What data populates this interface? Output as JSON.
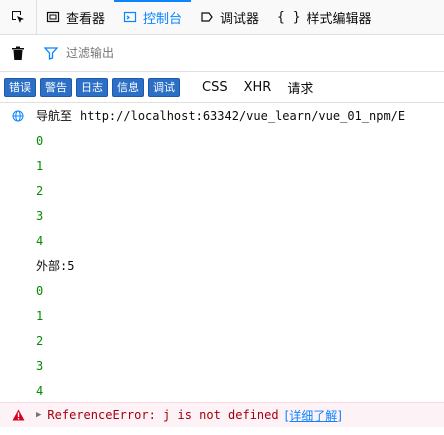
{
  "toolbar": {
    "tabs": [
      {
        "label": "查看器",
        "icon": "inspector-icon"
      },
      {
        "label": "控制台",
        "icon": "console-icon",
        "active": true
      },
      {
        "label": "调试器",
        "icon": "debugger-icon"
      },
      {
        "label": "样式编辑器",
        "icon": "style-editor-icon"
      }
    ]
  },
  "filter": {
    "placeholder": "过滤输出"
  },
  "levels": [
    "错误",
    "警告",
    "日志",
    "信息",
    "调试"
  ],
  "net_filters": [
    "CSS",
    "XHR",
    "请求"
  ],
  "console": {
    "navigation": {
      "label": "导航至",
      "url": "http://localhost:63342/vue_learn/vue_01_npm/E"
    },
    "inner_values": [
      "0",
      "1",
      "2",
      "3",
      "4"
    ],
    "outer_line": "外部:5",
    "second_values": [
      "0",
      "1",
      "2",
      "3",
      "4"
    ],
    "error": {
      "text": "ReferenceError: j is not defined",
      "learn_more": "[详细了解]"
    }
  },
  "colors": {
    "accent": "#0a84ff",
    "number": "#058b00",
    "error": "#a4000f",
    "level_button": "#2b6fc6"
  }
}
